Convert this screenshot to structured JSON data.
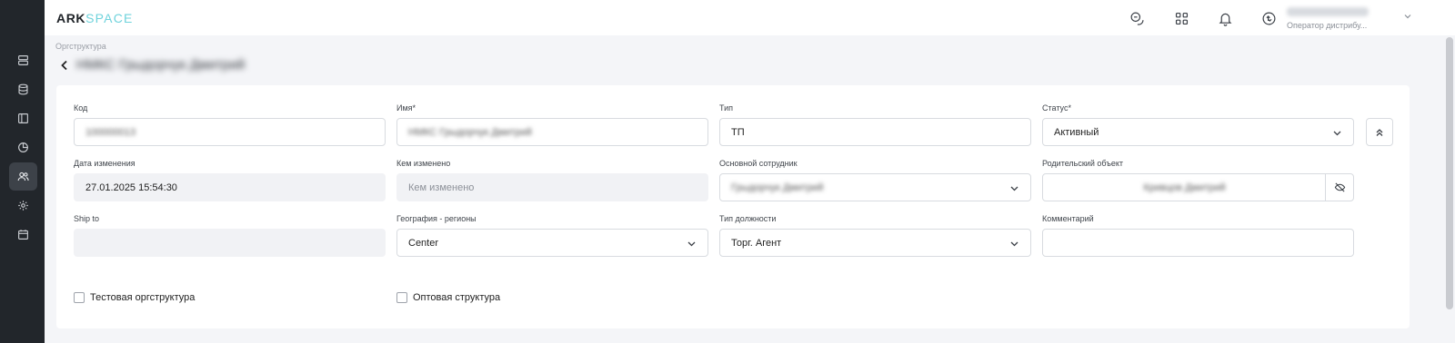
{
  "header": {
    "logo_part1": "ARK",
    "logo_part2": "SPACE",
    "user_name": "Малинов Николай",
    "user_role": "Оператор дистрибу..."
  },
  "breadcrumb": "Оргструктура",
  "page_title": "НМКС Грыдорчук Дмитрий",
  "form": {
    "code": {
      "label": "Код",
      "value": "100000013"
    },
    "name": {
      "label": "Имя*",
      "value": "НМКС Грыдорчук Дмитрий"
    },
    "type": {
      "label": "Тип",
      "value": "ТП"
    },
    "status": {
      "label": "Статус*",
      "value": "Активный"
    },
    "changed_date": {
      "label": "Дата изменения",
      "value": "27.01.2025 15:54:30"
    },
    "changed_by": {
      "label": "Кем изменено",
      "placeholder": "Кем изменено"
    },
    "main_employee": {
      "label": "Основной сотрудник",
      "value": "Грыдорчук Дмитрий"
    },
    "parent_object": {
      "label": "Родительский объект",
      "value": "Кривцов Дмитрий"
    },
    "ship_to": {
      "label": "Ship to",
      "value": ""
    },
    "geo_regions": {
      "label": "География - регионы",
      "value": "Center"
    },
    "position_type": {
      "label": "Тип должности",
      "value": "Торг. Агент"
    },
    "comment": {
      "label": "Комментарий",
      "value": ""
    },
    "test_orgstructure": {
      "label": "Тестовая оргструктура",
      "checked": false
    },
    "wholesale_structure": {
      "label": "Оптовая структура",
      "checked": false
    }
  },
  "icons": {
    "sidebar": [
      "list-icon",
      "database-icon",
      "layout-icon",
      "pie-chart-icon",
      "users-icon",
      "settings-icon",
      "calendar-icon"
    ],
    "header": [
      "chat-icon",
      "apps-grid-icon",
      "bell-icon",
      "sync-icon"
    ]
  },
  "colors": {
    "sidebar_bg": "#22262b",
    "accent": "#6fd3dc"
  }
}
